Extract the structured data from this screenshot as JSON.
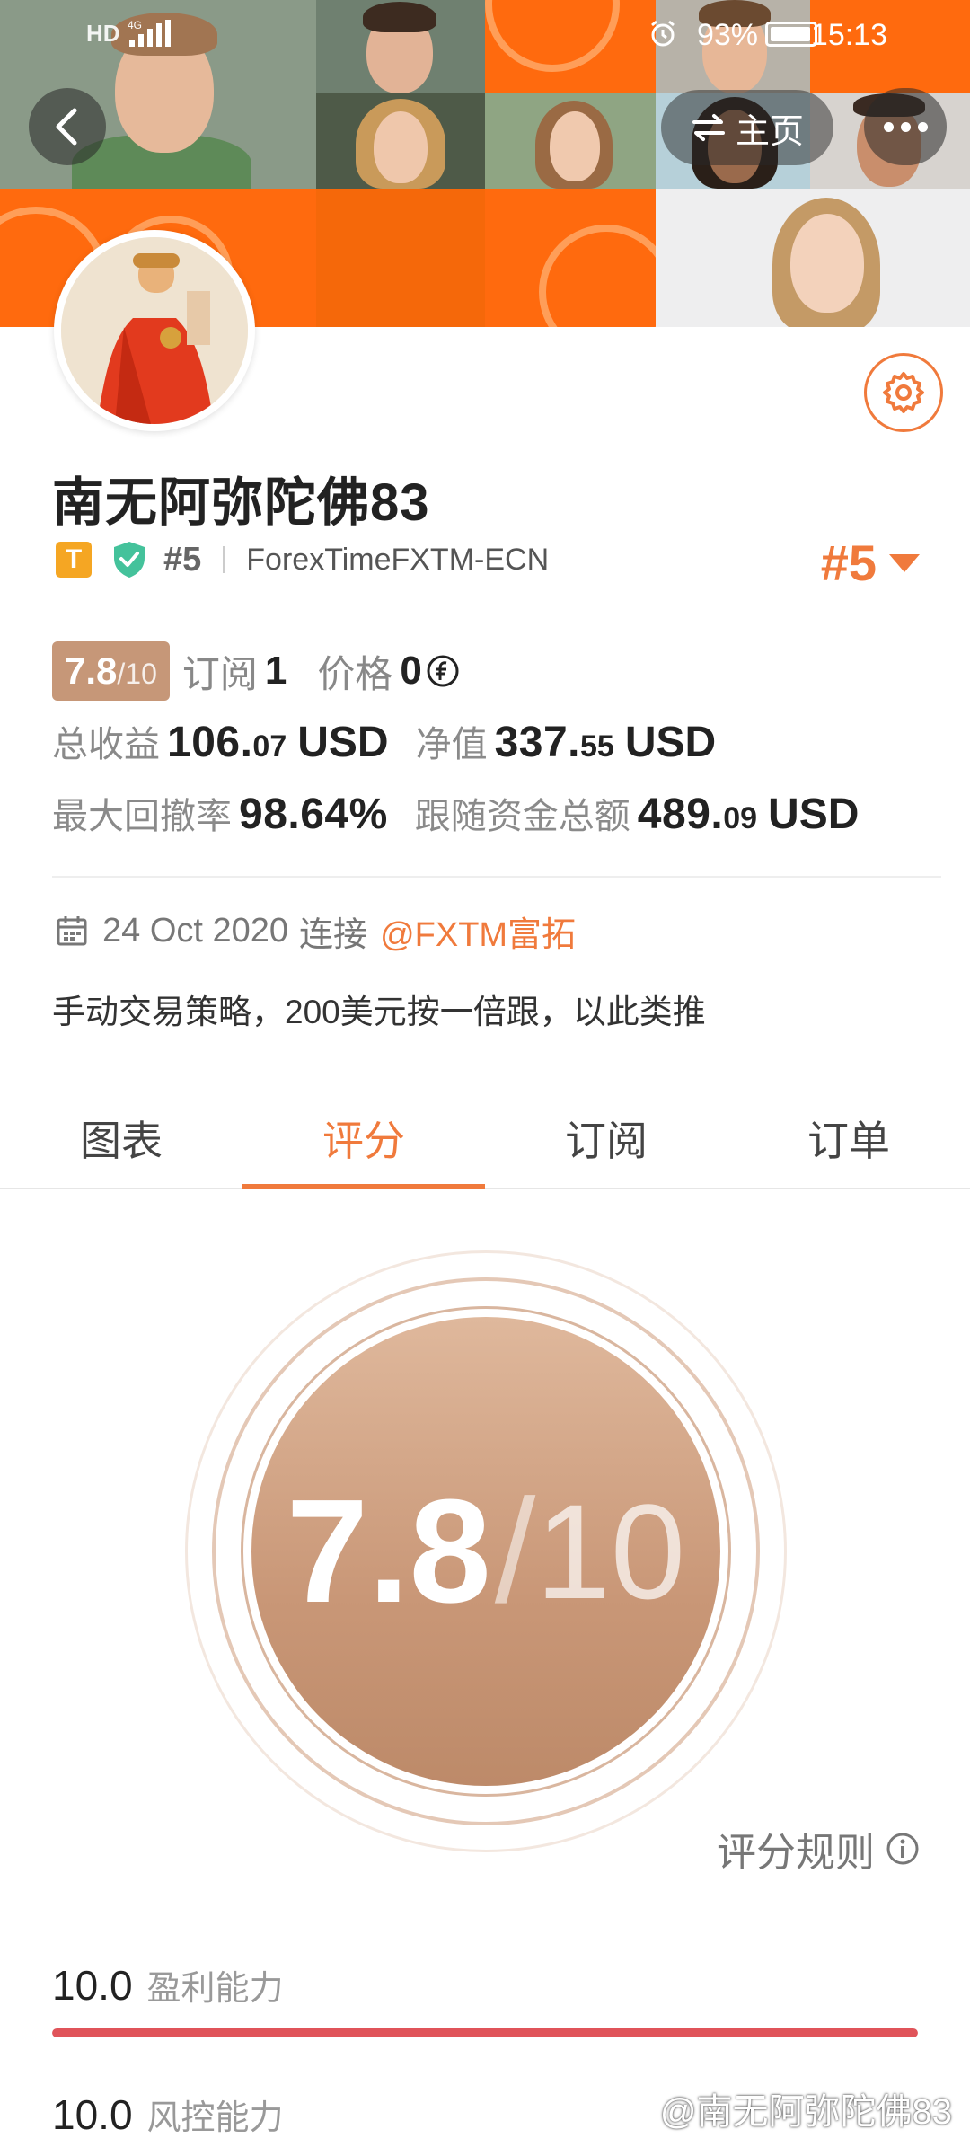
{
  "status_bar": {
    "left_tag": "HD",
    "battery_percent": "93%",
    "time": "15:13"
  },
  "nav": {
    "home_label": "主页"
  },
  "profile": {
    "username": "南无阿弥陀佛83",
    "badge_letter": "T",
    "rank_small": "#5",
    "broker": "ForexTimeFXTM-ECN",
    "rank_big": "#5"
  },
  "summary": {
    "score": "7.8",
    "score_max": "/10",
    "subscribe_label": "订阅",
    "subscribe_value": "1",
    "price_label": "价格",
    "price_value": "0"
  },
  "stats": {
    "total_profit_label": "总收益",
    "total_profit_int": "106.",
    "total_profit_dec": "07",
    "total_profit_unit": "USD",
    "equity_label": "净值",
    "equity_int": "337.",
    "equity_dec": "55",
    "equity_unit": "USD",
    "drawdown_label": "最大回撤率",
    "drawdown_value": "98.64%",
    "follow_funds_label": "跟随资金总额",
    "follow_funds_int": "489.",
    "follow_funds_dec": "09",
    "follow_funds_unit": "USD"
  },
  "connection": {
    "date": "24 Oct 2020",
    "connect_word": "连接",
    "broker_link": "@FXTM富拓"
  },
  "description": "手动交易策略，200美元按一倍跟，以此类推",
  "tabs": [
    {
      "label": "图表",
      "active": false
    },
    {
      "label": "评分",
      "active": true
    },
    {
      "label": "订阅",
      "active": false
    },
    {
      "label": "订单",
      "active": false
    }
  ],
  "score_panel": {
    "score": "7.8",
    "slash": "/",
    "max": "10",
    "rules_label": "评分规则"
  },
  "metrics": [
    {
      "value": "10.0",
      "name": "盈利能力",
      "fraction": 1.0,
      "color": "#e0545a"
    },
    {
      "value": "10.0",
      "name": "风控能力"
    }
  ],
  "watermark": "@南无阿弥陀佛83",
  "colors": {
    "accent": "#f07a3c",
    "score_chip": "#c69778",
    "banner_orange": "#ff6e14"
  }
}
